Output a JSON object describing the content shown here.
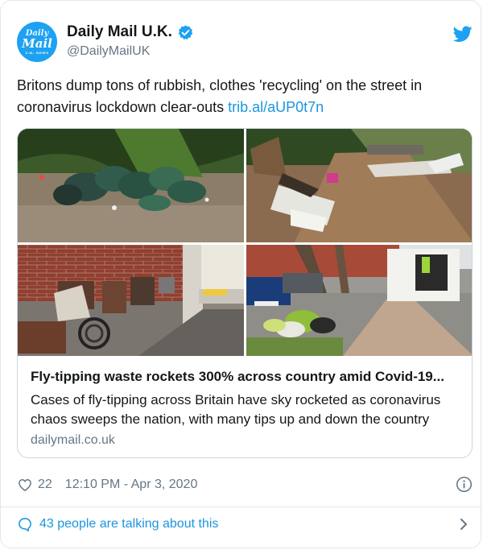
{
  "account": {
    "avatar_text": [
      "Daily",
      "Mail",
      "U.K. NEWS"
    ],
    "name": "Daily Mail U.K.",
    "handle": "@DailyMailUK",
    "verified": true
  },
  "tweet": {
    "text": "Britons dump tons of rubbish, clothes 'recycling' on the street in coronavirus lockdown clear-outs ",
    "link": "trib.al/aUP0t7n"
  },
  "link_card": {
    "images": [
      "dumped-bags-on-verge",
      "dumped-furniture-by-gate",
      "dumped-furniture-on-pavement",
      "van-and-dumped-bags-street"
    ],
    "title": "Fly-tipping waste rockets 300% across country amid Covid-19...",
    "description": "Cases of fly-tipping across Britain have sky rocketed as coronavirus chaos sweeps the nation, with many tips up and down the country",
    "domain": "dailymail.co.uk"
  },
  "meta": {
    "likes": "22",
    "timestamp": "12:10 PM - Apr 3, 2020"
  },
  "conversation": {
    "label": "43 people are talking about this"
  },
  "icons": {
    "brand": "twitter-bird-icon",
    "verified": "verified-badge-icon",
    "like": "heart-icon",
    "info": "info-icon",
    "reply": "speech-bubble-icon",
    "chevron": "chevron-right-icon"
  },
  "colors": {
    "brand_blue": "#1da1f2",
    "link_blue": "#1b95e0",
    "secondary_text": "#657786",
    "border": "#e1e8ed"
  }
}
